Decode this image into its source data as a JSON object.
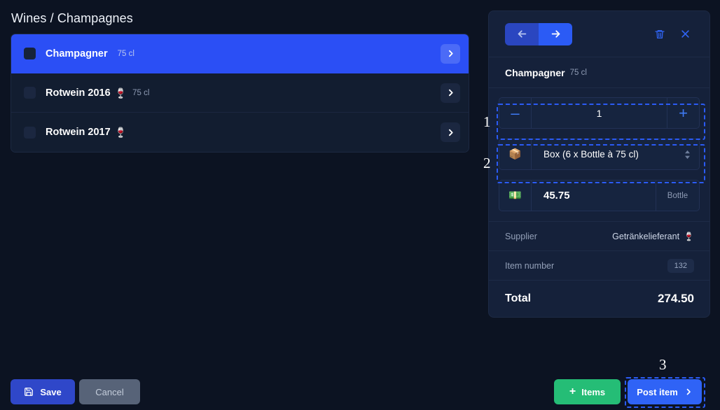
{
  "page": {
    "title": "Wines / Champagnes",
    "background_color": "#0c1322",
    "accent_color": "#2b4ff5"
  },
  "list": {
    "rows": [
      {
        "name": "Champagner",
        "emoji": "",
        "volume": "75 cl",
        "selected": true,
        "chevron_icon": "chevron-right-icon",
        "checkbox_checked": false
      },
      {
        "name": "Rotwein 2016",
        "emoji": "🍷",
        "volume": "75 cl",
        "selected": false,
        "chevron_icon": "chevron-right-icon",
        "checkbox_checked": false
      },
      {
        "name": "Rotwein 2017",
        "emoji": "🍷",
        "volume": "",
        "selected": false,
        "chevron_icon": "chevron-right-icon",
        "checkbox_checked": false
      }
    ]
  },
  "detail_panel": {
    "toolbar": {
      "prev_icon": "arrow-left-icon",
      "next_icon": "arrow-right-icon",
      "delete_icon": "trash-icon",
      "close_icon": "close-icon"
    },
    "item_name": "Champagner",
    "item_volume": "75 cl",
    "quantity": {
      "decrement_label": "–",
      "value": "1",
      "increment_label": "+"
    },
    "packaging": {
      "icon": "📦",
      "value": "Box (6 x Bottle à 75 cl)",
      "caret_icon": "select-caret-icon"
    },
    "price": {
      "icon": "💵",
      "value": "45.75",
      "unit": "Bottle"
    },
    "details": [
      {
        "label": "Supplier",
        "value": "Getränkelieferant",
        "emoji": "🍷",
        "badge": ""
      },
      {
        "label": "Item number",
        "value": "",
        "emoji": "",
        "badge": "132"
      }
    ],
    "total": {
      "label": "Total",
      "value": "274.50"
    }
  },
  "annotations": {
    "markers": [
      {
        "number": "1",
        "target": "quantity-stepper"
      },
      {
        "number": "2",
        "target": "packaging-select"
      },
      {
        "number": "3",
        "target": "post-item-button"
      }
    ],
    "highlight_color": "#2b5bf5"
  },
  "bottom_bar": {
    "save": {
      "label": "Save",
      "icon": "save-icon"
    },
    "cancel": {
      "label": "Cancel"
    },
    "items": {
      "label": "Items",
      "icon": "plus-icon"
    },
    "post_item": {
      "label": "Post item",
      "icon": "chevron-right-icon"
    }
  }
}
